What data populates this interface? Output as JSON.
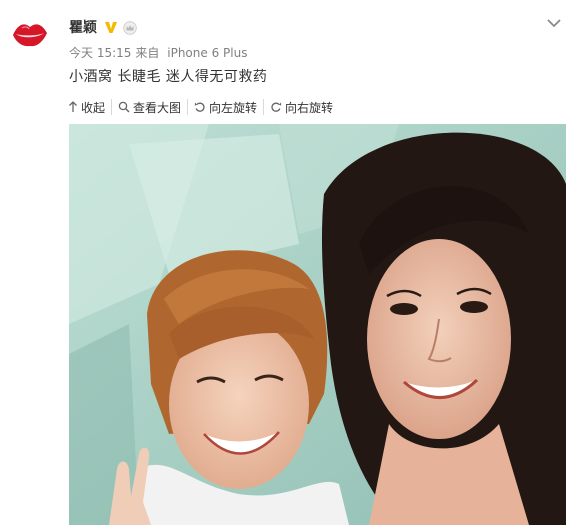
{
  "user": {
    "name": "瞿颖",
    "avatar_icon": "lips-icon",
    "verified_icon": "verified-v-icon",
    "member_icon": "member-crown-icon"
  },
  "meta": {
    "time": "今天 15:15",
    "source_prefix": "来自",
    "device": "iPhone 6 Plus"
  },
  "post": {
    "text": "小酒窝 长睫毛 迷人得无可救药"
  },
  "toolbar": {
    "collapse": "收起",
    "view_large": "查看大图",
    "rotate_left": "向左旋转",
    "rotate_right": "向右旋转"
  },
  "colors": {
    "avatar_red": "#d6172a",
    "verified_gold": "#f5b900",
    "photo_teal": "#a9cfc5"
  }
}
